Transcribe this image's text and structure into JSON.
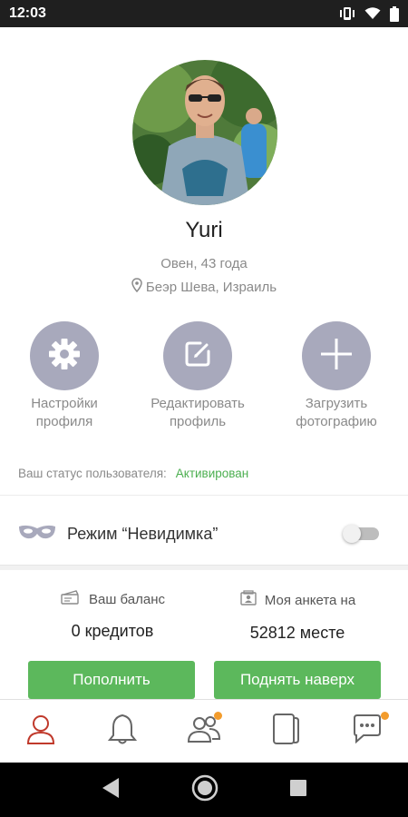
{
  "status_bar": {
    "time": "12:03"
  },
  "profile": {
    "name": "Yuri",
    "subtitle": "Овен, 43 года",
    "location": "Беэр Шева, Израиль"
  },
  "actions": [
    {
      "label": "Настройки\nпрофиля",
      "icon": "gear-icon"
    },
    {
      "label": "Редактировать\nпрофиль",
      "icon": "edit-icon"
    },
    {
      "label": "Загрузить\nфотографию",
      "icon": "plus-icon"
    }
  ],
  "user_status": {
    "label": "Ваш статус пользователя:",
    "value": "Активирован"
  },
  "invisible_mode": {
    "label": "Режим “Невидимка”",
    "enabled": false
  },
  "balance": {
    "label": "Ваш баланс",
    "value": "0 кредитов",
    "button": "Пополнить"
  },
  "rank": {
    "label": "Моя анкета на",
    "value": "52812 месте",
    "button": "Поднять наверх"
  },
  "bottom_nav": [
    {
      "icon": "profile-icon",
      "active": true,
      "badge": false
    },
    {
      "icon": "bell-icon",
      "active": false,
      "badge": true
    },
    {
      "icon": "people-icon",
      "active": false,
      "badge": false
    },
    {
      "icon": "cards-icon",
      "active": false,
      "badge": false
    },
    {
      "icon": "chat-icon",
      "active": false,
      "badge": true
    }
  ],
  "colors": {
    "accent_green": "#5cb85c",
    "status_green": "#4caf50",
    "active_nav": "#c0392b",
    "badge_orange": "#f39c2c",
    "action_circle": "#a8a9bc"
  }
}
